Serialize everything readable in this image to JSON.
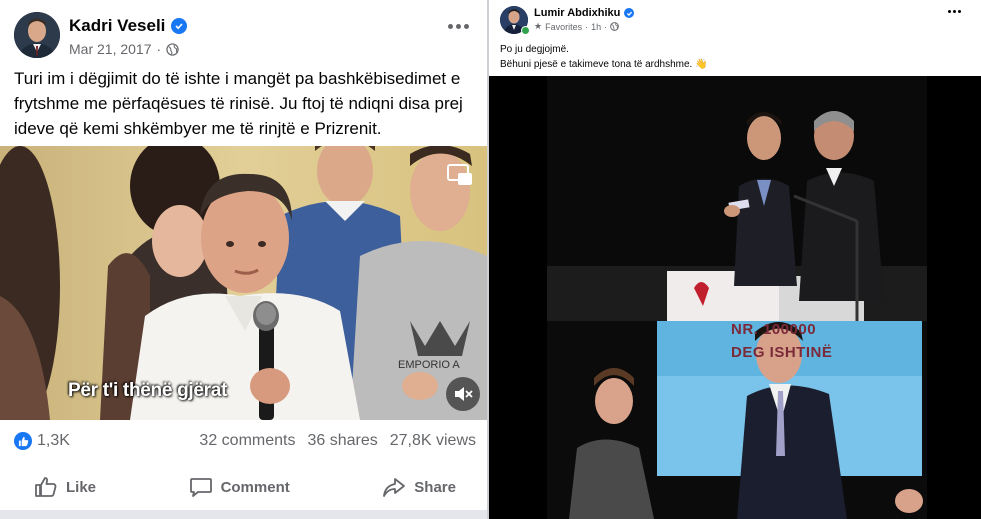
{
  "left_post": {
    "author": "Kadri Veseli",
    "date": "Mar 21, 2017",
    "separator": "·",
    "text": "Turi im i dëgjimit do të ishte i mangët pa bashkëbisedimet e frytshme me përfaqësues të rinisë. Ju ftoj të ndiqni disa prej ideve që kemi shkëmbyer me të rinjtë e Prizrenit.",
    "video_caption": "Për t'i thënë gjërat",
    "shirt_brand": "EMPORIO ARMANI",
    "stats": {
      "likes": "1,3K",
      "comments": "32 comments",
      "shares": "36 shares",
      "views": "27,8K views"
    },
    "actions": {
      "like": "Like",
      "comment": "Comment",
      "share": "Share"
    },
    "icons": [
      "verified-icon",
      "globe-icon",
      "more-icon",
      "pip-icon",
      "mute-icon",
      "like-icon",
      "comment-icon",
      "share-icon"
    ]
  },
  "right_post": {
    "author": "Lumir Abdixhiku",
    "meta_label": "Favorites",
    "separator": "·",
    "time": "1h",
    "text_line1": "Po ju degjojmë.",
    "text_line2": "Bëhuni pjesë e takimeve tona të ardhshme. 👋",
    "sign_line1": "NR. 100000",
    "sign_line2": "DEG        ISHTINË",
    "icons": [
      "verified-icon",
      "star-icon",
      "globe-icon",
      "more-icon"
    ]
  },
  "colors": {
    "facebook_blue": "#1877f2",
    "secondary_text": "#65676b",
    "online_green": "#31a24c"
  }
}
